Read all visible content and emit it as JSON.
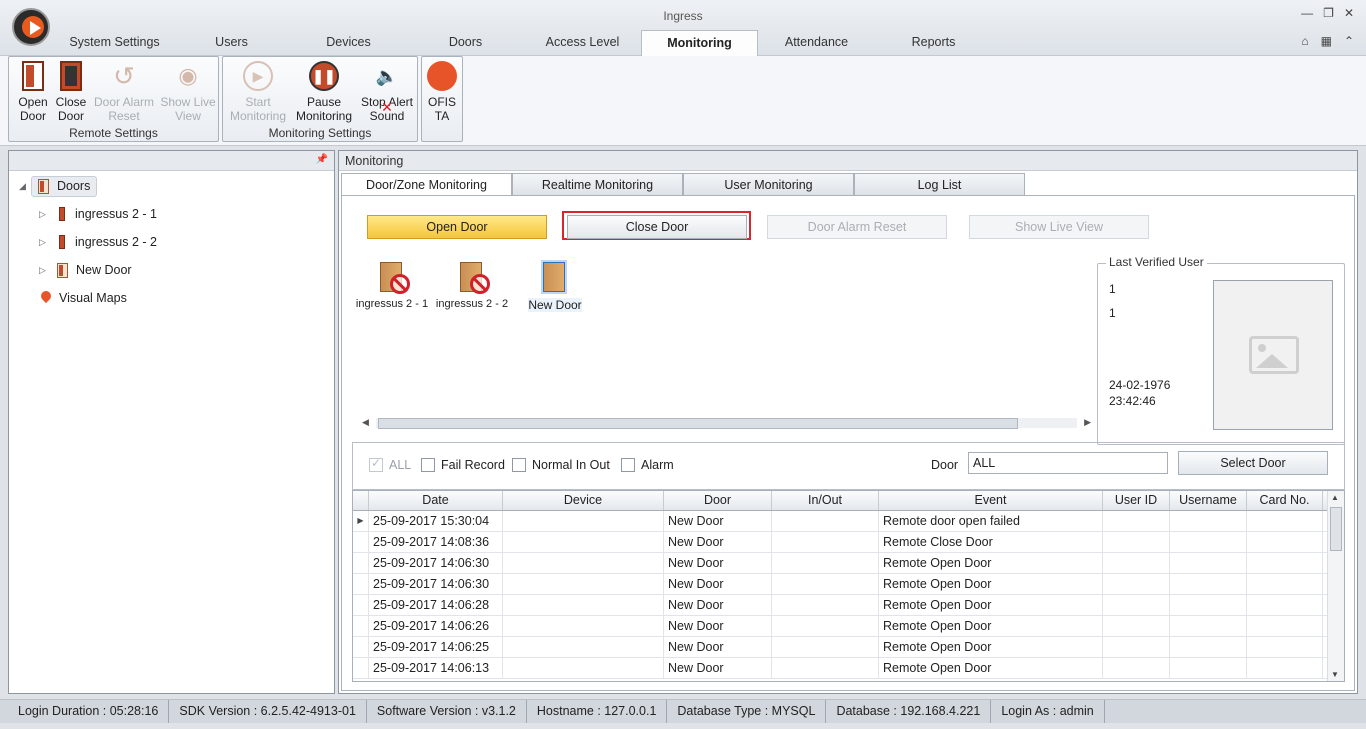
{
  "window": {
    "title": "Ingress"
  },
  "tabs": [
    "System Settings",
    "Users",
    "Devices",
    "Doors",
    "Access Level",
    "Monitoring",
    "Attendance",
    "Reports"
  ],
  "active_tab": "Monitoring",
  "ribbon": {
    "remote_settings": {
      "label": "Remote Settings",
      "open_door": "Open\nDoor",
      "close_door": "Close\nDoor",
      "door_alarm_reset": "Door Alarm\nReset",
      "show_live_view": "Show Live\nView"
    },
    "monitoring_settings": {
      "label": "Monitoring Settings",
      "start_monitoring": "Start\nMonitoring",
      "pause_monitoring": "Pause\nMonitoring",
      "stop_alert_sound": "Stop Alert\nSound"
    },
    "ofis_ta": "OFIS\nTA"
  },
  "tree": {
    "root": "Doors",
    "items": [
      "ingressus 2 - 1",
      "ingressus 2 - 2",
      "New Door"
    ],
    "visual_maps": "Visual Maps"
  },
  "main": {
    "title": "Monitoring",
    "sub_tabs": [
      "Door/Zone Monitoring",
      "Realtime Monitoring",
      "User Monitoring",
      "Log List"
    ],
    "buttons": {
      "open_door": "Open Door",
      "close_door": "Close Door",
      "door_alarm_reset": "Door Alarm Reset",
      "show_live_view": "Show Live View"
    },
    "doors": [
      {
        "name": "ingressus 2 - 1",
        "state": "blocked"
      },
      {
        "name": "ingressus 2 - 2",
        "state": "blocked"
      },
      {
        "name": "New Door",
        "state": "selected"
      }
    ],
    "last_verified": {
      "legend": "Last Verified User",
      "line1": "1",
      "line2": "1",
      "date": "24-02-1976",
      "time": "23:42:46"
    },
    "filters": {
      "all": "ALL",
      "fail_record": "Fail Record",
      "normal_in_out": "Normal In Out",
      "alarm": "Alarm",
      "door_label": "Door",
      "door_value": "ALL",
      "select_door": "Select Door"
    },
    "grid": {
      "headers": [
        "Date",
        "Device",
        "Door",
        "In/Out",
        "Event",
        "User ID",
        "Username",
        "Card No."
      ],
      "rows": [
        [
          "25-09-2017 15:30:04",
          "",
          "New Door",
          "",
          "Remote door open failed",
          "",
          "",
          ""
        ],
        [
          "25-09-2017 14:08:36",
          "",
          "New Door",
          "",
          "Remote Close Door",
          "",
          "",
          ""
        ],
        [
          "25-09-2017 14:06:30",
          "",
          "New Door",
          "",
          "Remote Open Door",
          "",
          "",
          ""
        ],
        [
          "25-09-2017 14:06:30",
          "",
          "New Door",
          "",
          "Remote Open Door",
          "",
          "",
          ""
        ],
        [
          "25-09-2017 14:06:28",
          "",
          "New Door",
          "",
          "Remote Open Door",
          "",
          "",
          ""
        ],
        [
          "25-09-2017 14:06:26",
          "",
          "New Door",
          "",
          "Remote Open Door",
          "",
          "",
          ""
        ],
        [
          "25-09-2017 14:06:25",
          "",
          "New Door",
          "",
          "Remote Open Door",
          "",
          "",
          ""
        ],
        [
          "25-09-2017 14:06:13",
          "",
          "New Door",
          "",
          "Remote Open Door",
          "",
          "",
          ""
        ]
      ]
    }
  },
  "status": [
    "Login Duration : 05:28:16",
    "SDK Version : 6.2.5.42-4913-01",
    "Software Version : v3.1.2",
    "Hostname : 127.0.0.1",
    "Database Type : MYSQL",
    "Database : 192.168.4.221",
    "Login As : admin"
  ],
  "colors": {
    "accent_gold": "#f6c53a",
    "highlight_red": "#d7272d",
    "door_red": "#c14b2a"
  }
}
